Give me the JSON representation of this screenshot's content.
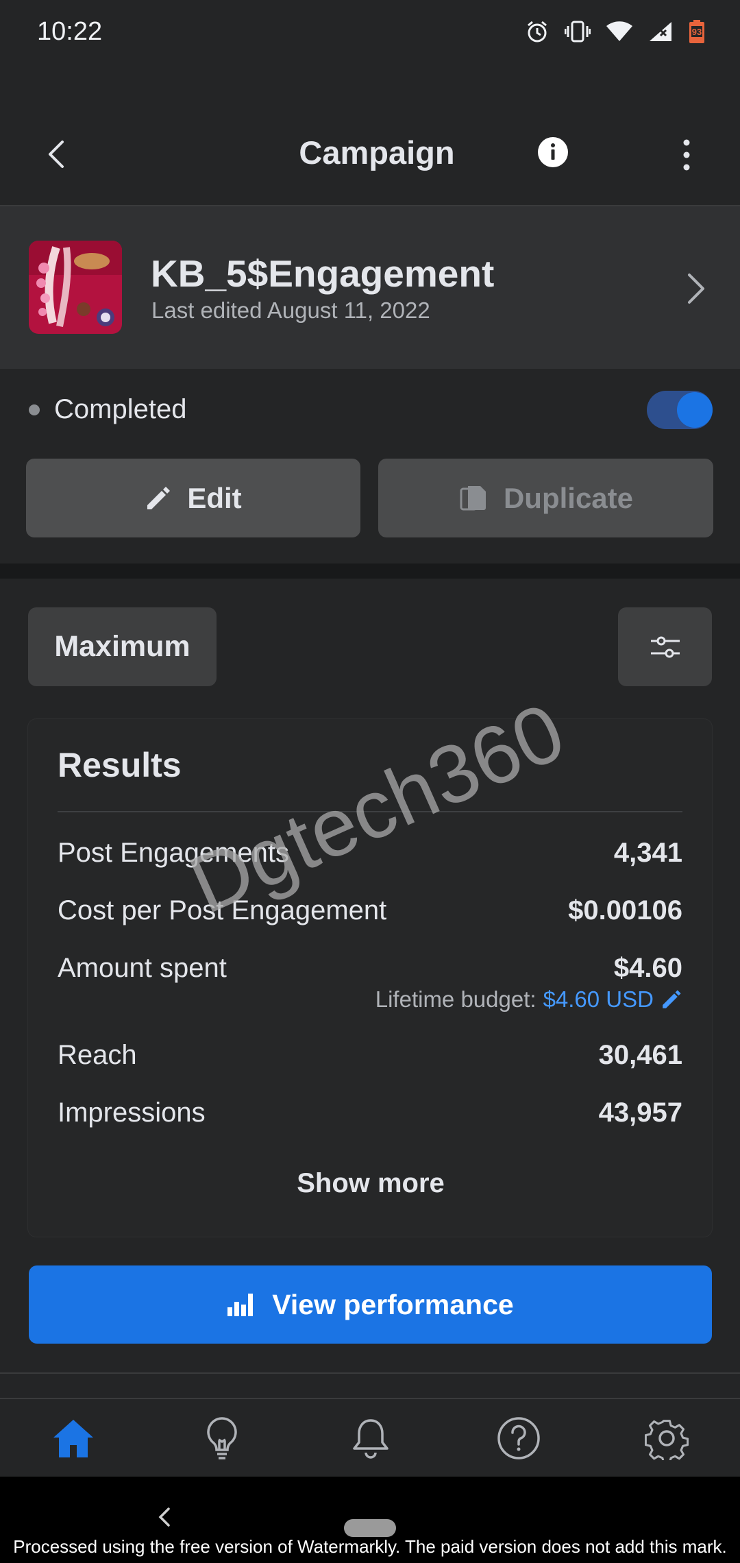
{
  "status_bar": {
    "time": "10:22",
    "battery_level": "93"
  },
  "header": {
    "title": "Campaign"
  },
  "campaign": {
    "name": "KB_5$Engagement",
    "last_edited": "Last edited August 11, 2022"
  },
  "status": {
    "label": "Completed",
    "toggle_on": true
  },
  "actions": {
    "edit_label": "Edit",
    "duplicate_label": "Duplicate"
  },
  "filters": {
    "range_label": "Maximum"
  },
  "results": {
    "title": "Results",
    "metrics": [
      {
        "label": "Post Engagements",
        "value": "4,341"
      },
      {
        "label": "Cost per Post Engagement",
        "value": "$0.00106"
      },
      {
        "label": "Amount spent",
        "value": "$4.60"
      },
      {
        "label": "Reach",
        "value": "30,461"
      },
      {
        "label": "Impressions",
        "value": "43,957"
      }
    ],
    "budget_label": "Lifetime budget:",
    "budget_value": "$4.60 USD",
    "show_more": "Show more"
  },
  "view_performance_label": "View performance",
  "bottom_nav": [
    {
      "name": "home-icon",
      "active": true
    },
    {
      "name": "lightbulb-icon",
      "active": false
    },
    {
      "name": "bell-icon",
      "active": false
    },
    {
      "name": "help-icon",
      "active": false
    },
    {
      "name": "settings-icon",
      "active": false
    }
  ],
  "watermark": {
    "overlay": "Dgtech360",
    "footer": "Processed using the free version of Watermarkly. The paid version does not add this mark."
  },
  "colors": {
    "accent": "#1b74e4",
    "link": "#4599ff",
    "background": "#242526"
  }
}
